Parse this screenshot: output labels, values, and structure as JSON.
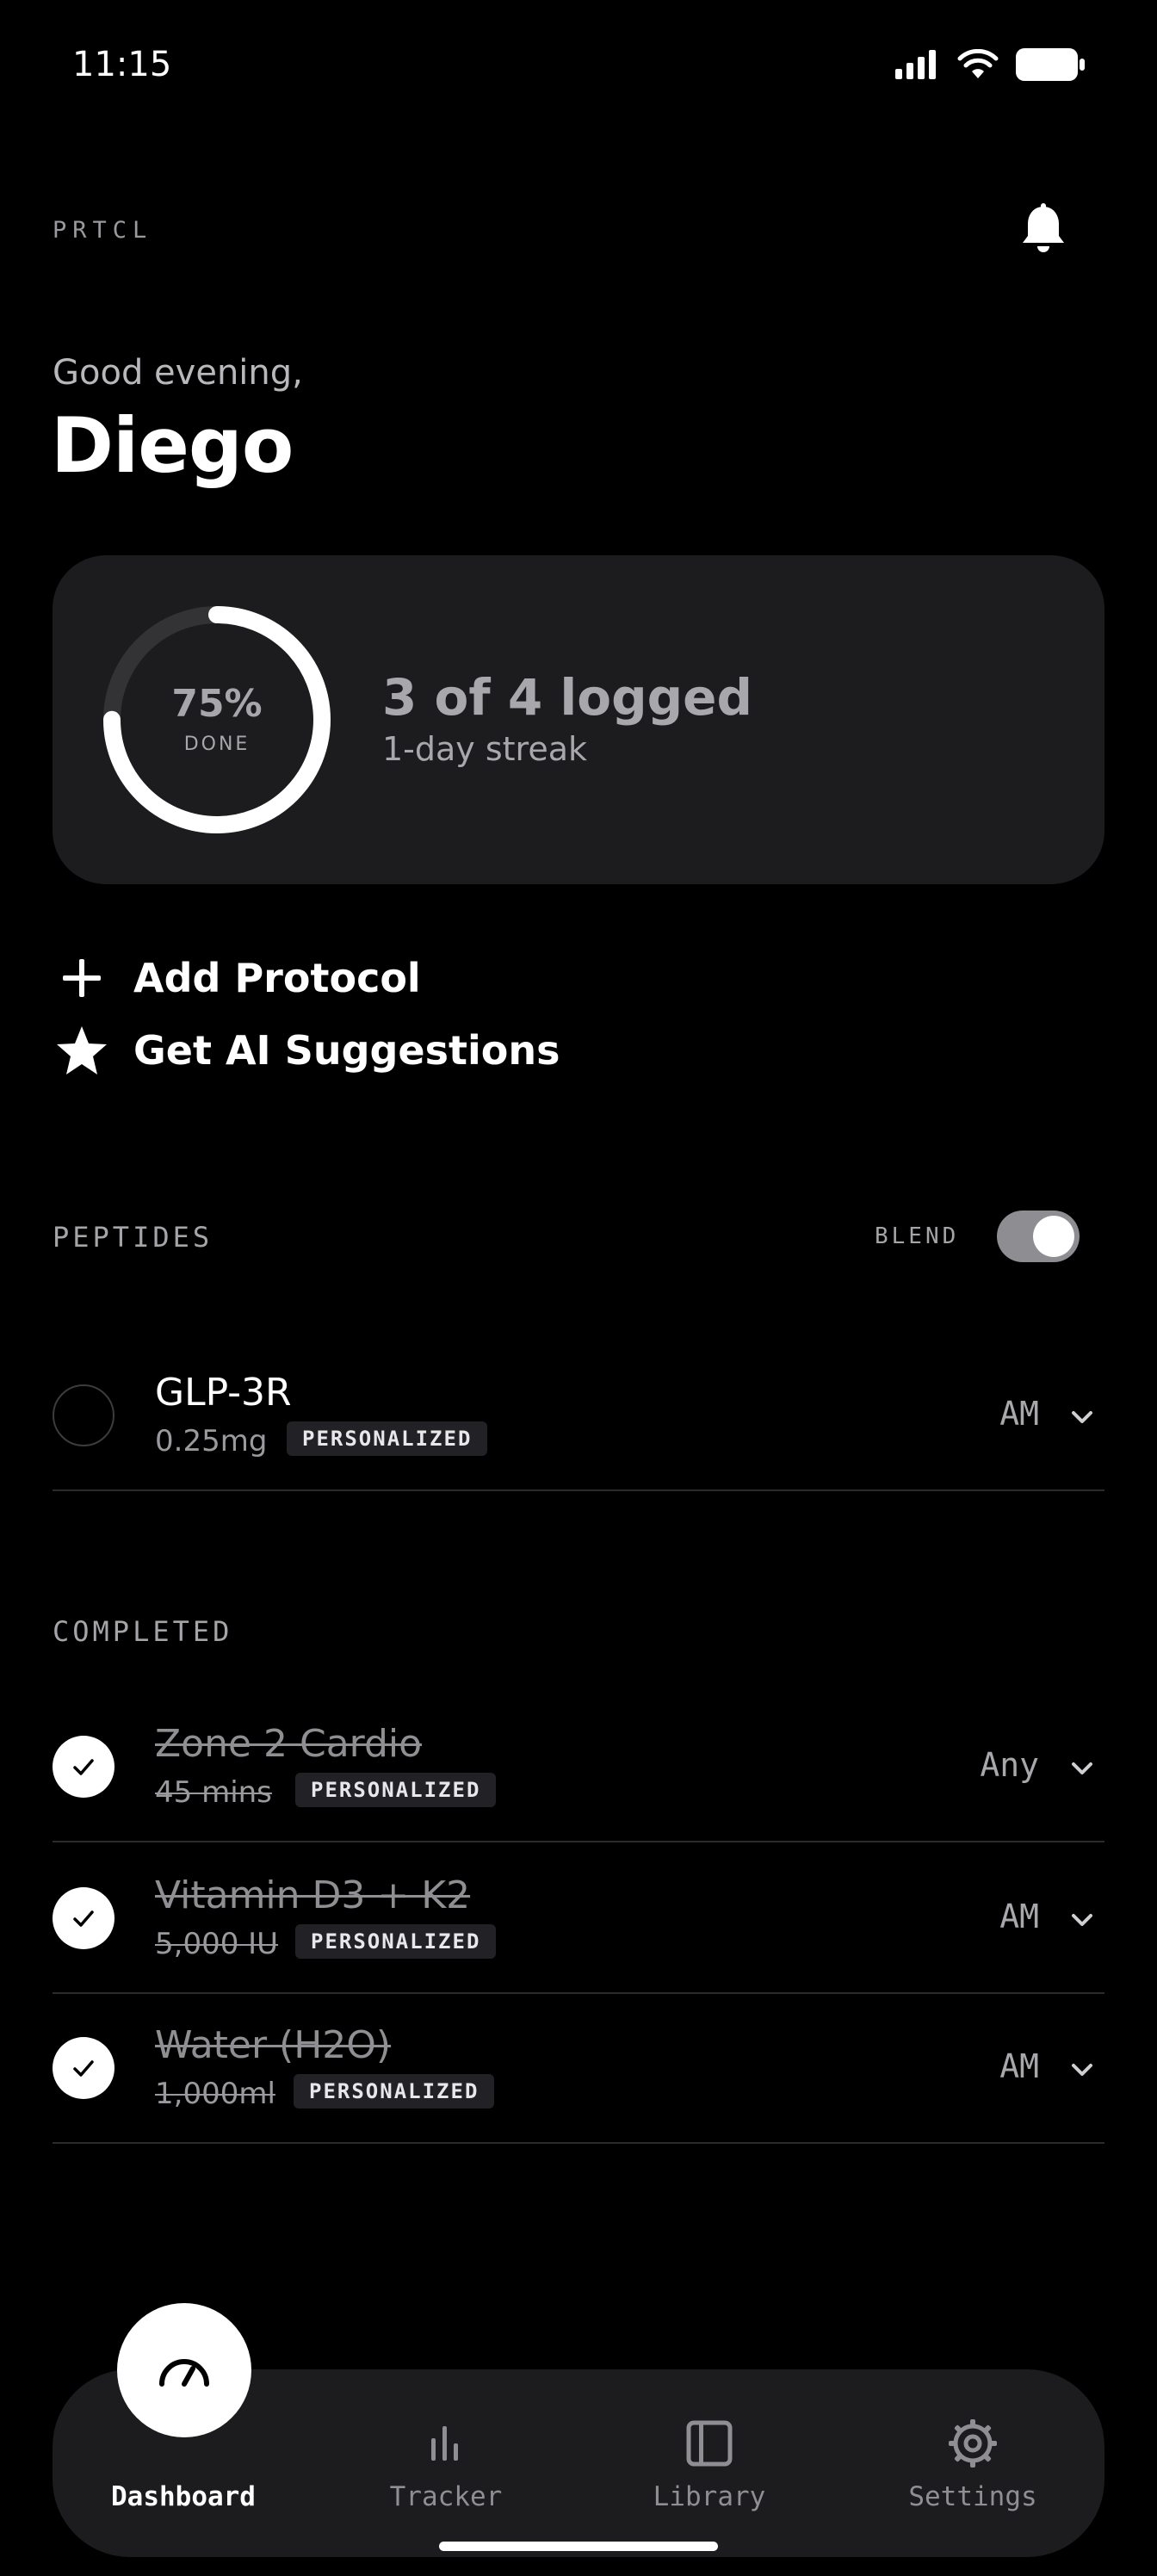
{
  "status_bar": {
    "time": "11:15"
  },
  "header": {
    "brand": "PRTCL",
    "bell_icon": "bell-icon"
  },
  "greeting": {
    "line": "Good evening,",
    "name": "Diego"
  },
  "summary": {
    "percent_text": "75%",
    "percent_value": 0.75,
    "done_label": "DONE",
    "logged": "3 of 4 logged",
    "streak": "1-day streak"
  },
  "actions": [
    {
      "label": "Add Protocol",
      "icon": "plus-icon"
    },
    {
      "label": "Get AI Suggestions",
      "icon": "star-icon"
    }
  ],
  "peptides": {
    "header": "PEPTIDES",
    "blend_label": "BLEND",
    "blend_on": true,
    "items": [
      {
        "name": "GLP-3R",
        "dose": "0.25mg",
        "badge": "PERSONALIZED",
        "time": "AM",
        "done": false
      }
    ]
  },
  "completed": {
    "header": "COMPLETED",
    "items": [
      {
        "name": "Zone 2 Cardio",
        "dose": "45 mins",
        "badge": "PERSONALIZED",
        "time": "Any",
        "done": true
      },
      {
        "name": "Vitamin D3 + K2",
        "dose": "5,000 IU",
        "badge": "PERSONALIZED",
        "time": "AM",
        "done": true
      },
      {
        "name": "Water (H2O)",
        "dose": "1,000ml",
        "badge": "PERSONALIZED",
        "time": "AM",
        "done": true
      }
    ]
  },
  "nav": {
    "items": [
      {
        "label": "Dashboard",
        "icon": "gauge-icon",
        "active": true
      },
      {
        "label": "Tracker",
        "icon": "bar-chart-icon",
        "active": false
      },
      {
        "label": "Library",
        "icon": "sidebar-panel-icon",
        "active": false
      },
      {
        "label": "Settings",
        "icon": "gear-icon",
        "active": false
      }
    ]
  }
}
